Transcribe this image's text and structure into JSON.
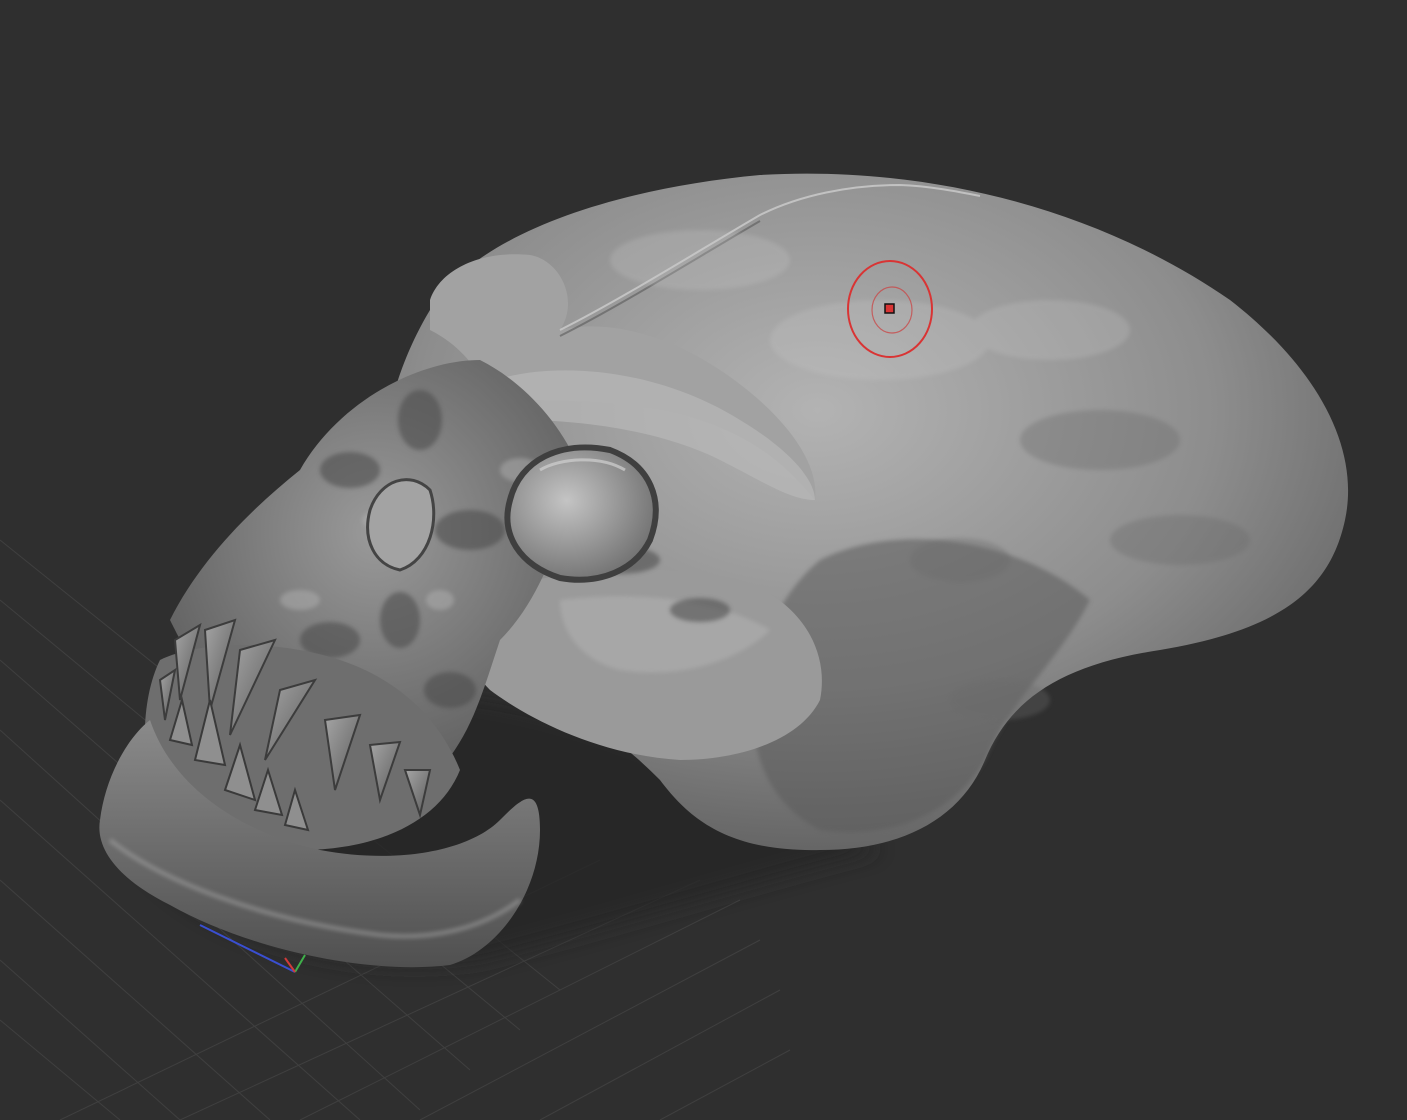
{
  "app": {
    "viewport": {
      "background": "#2f2f2f",
      "grid_color": "#4a4a4a",
      "model": {
        "name": "skull-sculpt",
        "base_color": "#8c8c8c",
        "shadow_color": "#3e3e3e",
        "highlight_color": "#c9c9c9"
      },
      "brush_cursor": {
        "icon": "brush-cursor-icon",
        "color": "#d93434"
      },
      "axis_gizmo": {
        "icon": "axis-gizmo-icon",
        "x_color": "#d13a3a",
        "y_color": "#3fb04a",
        "z_color": "#3a4fd1"
      }
    }
  }
}
